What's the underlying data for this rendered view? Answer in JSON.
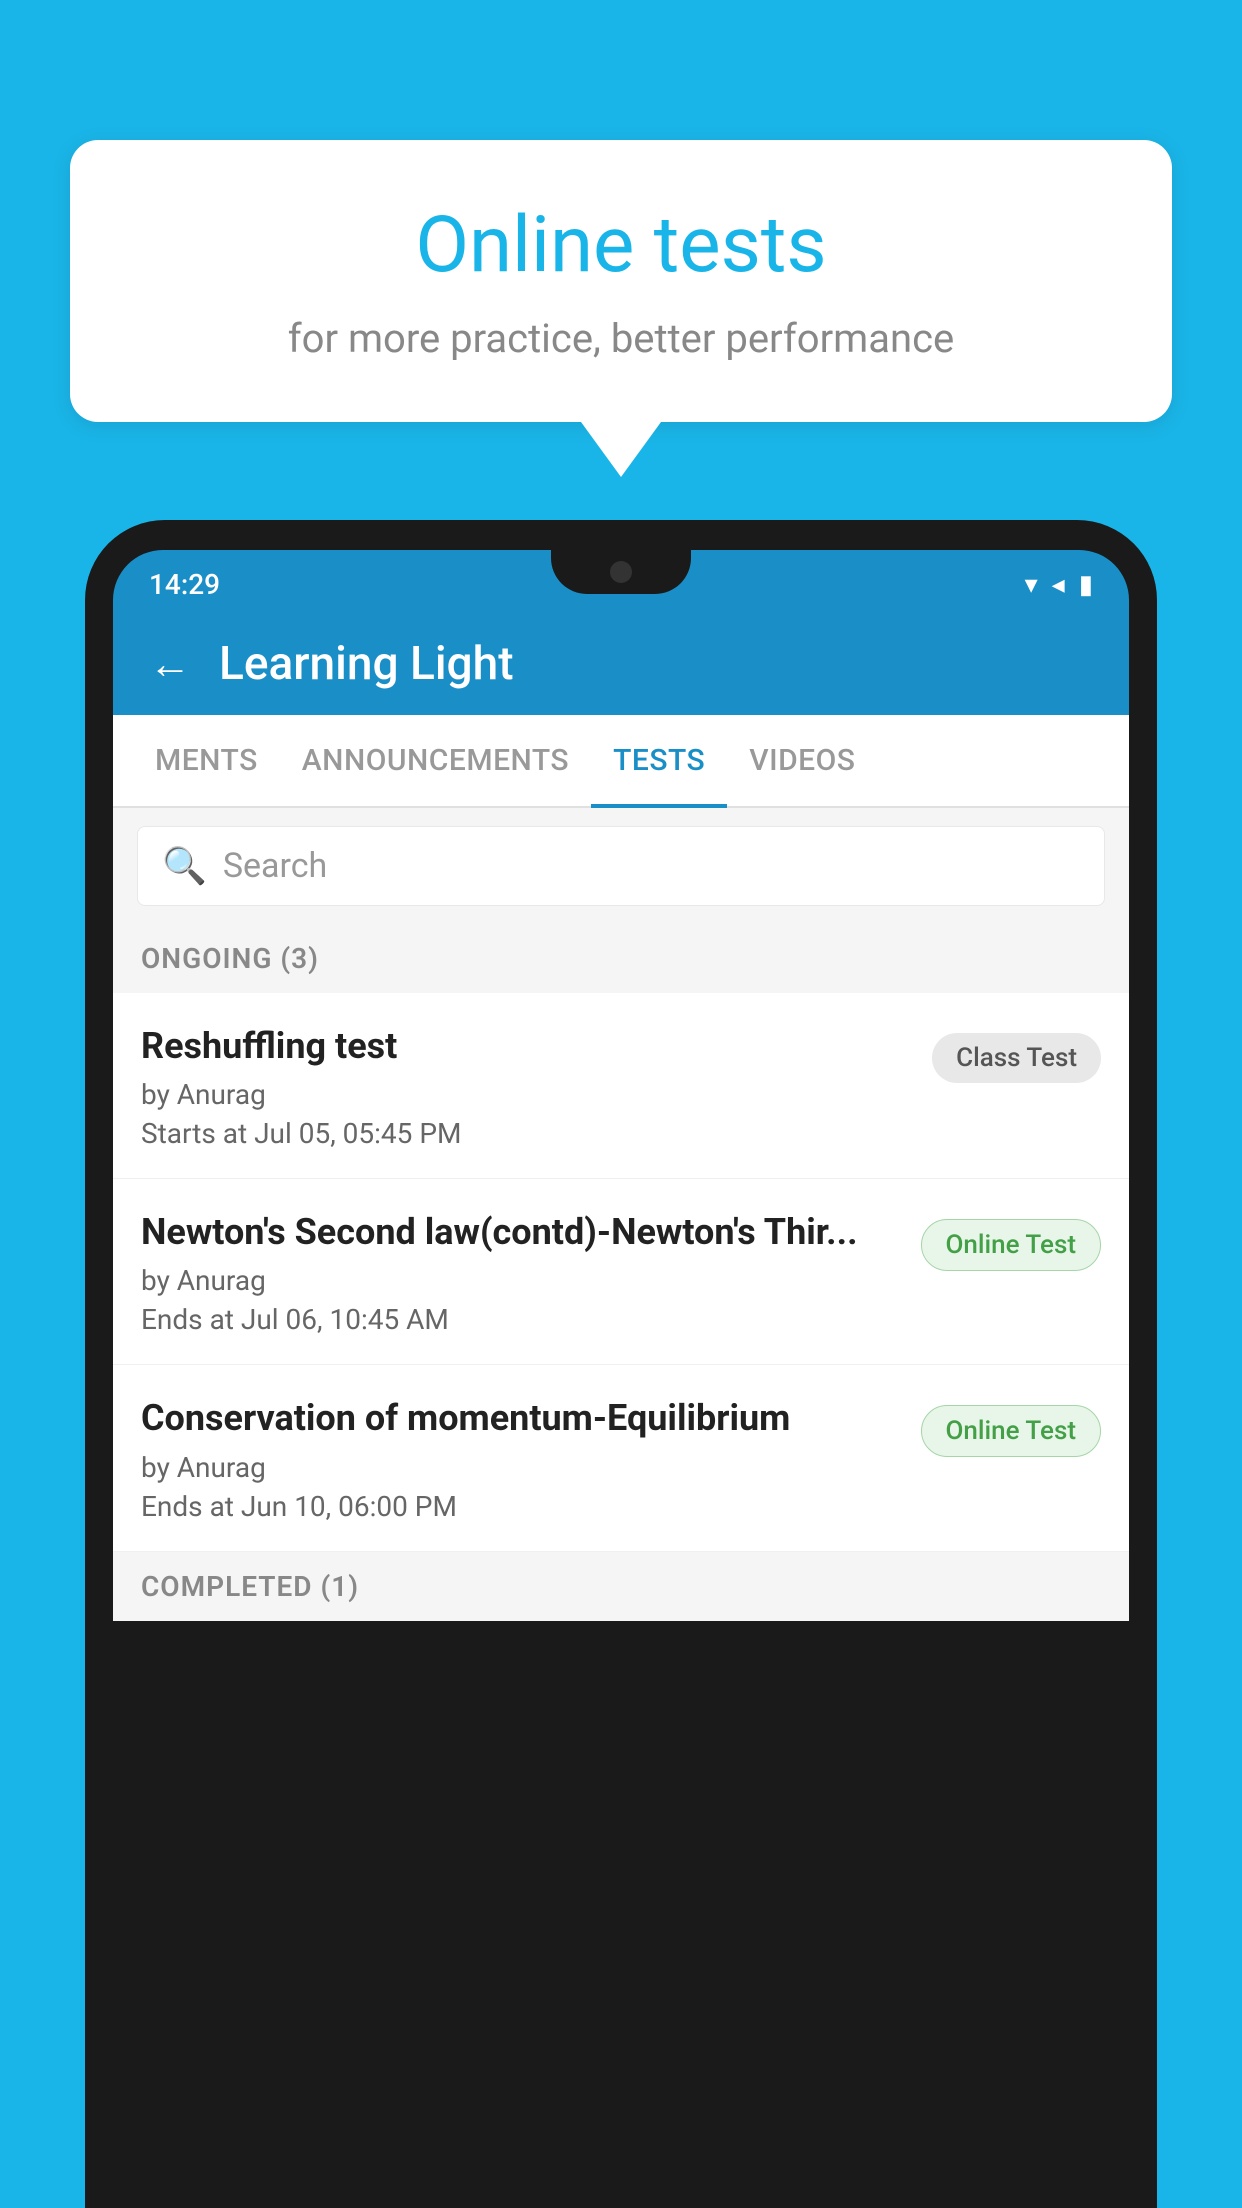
{
  "background_color": "#1ab5e8",
  "speech_bubble": {
    "title": "Online tests",
    "subtitle": "for more practice, better performance"
  },
  "phone": {
    "status_bar": {
      "time": "14:29",
      "icons": [
        "wifi",
        "signal",
        "battery"
      ]
    },
    "header": {
      "back_label": "←",
      "title": "Learning Light"
    },
    "tabs": [
      {
        "label": "MENTS",
        "active": false
      },
      {
        "label": "ANNOUNCEMENTS",
        "active": false
      },
      {
        "label": "TESTS",
        "active": true
      },
      {
        "label": "VIDEOS",
        "active": false
      }
    ],
    "search": {
      "placeholder": "Search"
    },
    "ongoing_section": {
      "label": "ONGOING (3)"
    },
    "tests": [
      {
        "name": "Reshuffling test",
        "by": "by Anurag",
        "time": "Starts at  Jul 05, 05:45 PM",
        "badge": "Class Test",
        "badge_type": "class"
      },
      {
        "name": "Newton's Second law(contd)-Newton's Thir...",
        "by": "by Anurag",
        "time": "Ends at  Jul 06, 10:45 AM",
        "badge": "Online Test",
        "badge_type": "online"
      },
      {
        "name": "Conservation of momentum-Equilibrium",
        "by": "by Anurag",
        "time": "Ends at  Jun 10, 06:00 PM",
        "badge": "Online Test",
        "badge_type": "online"
      }
    ],
    "completed_section": {
      "label": "COMPLETED (1)"
    }
  }
}
